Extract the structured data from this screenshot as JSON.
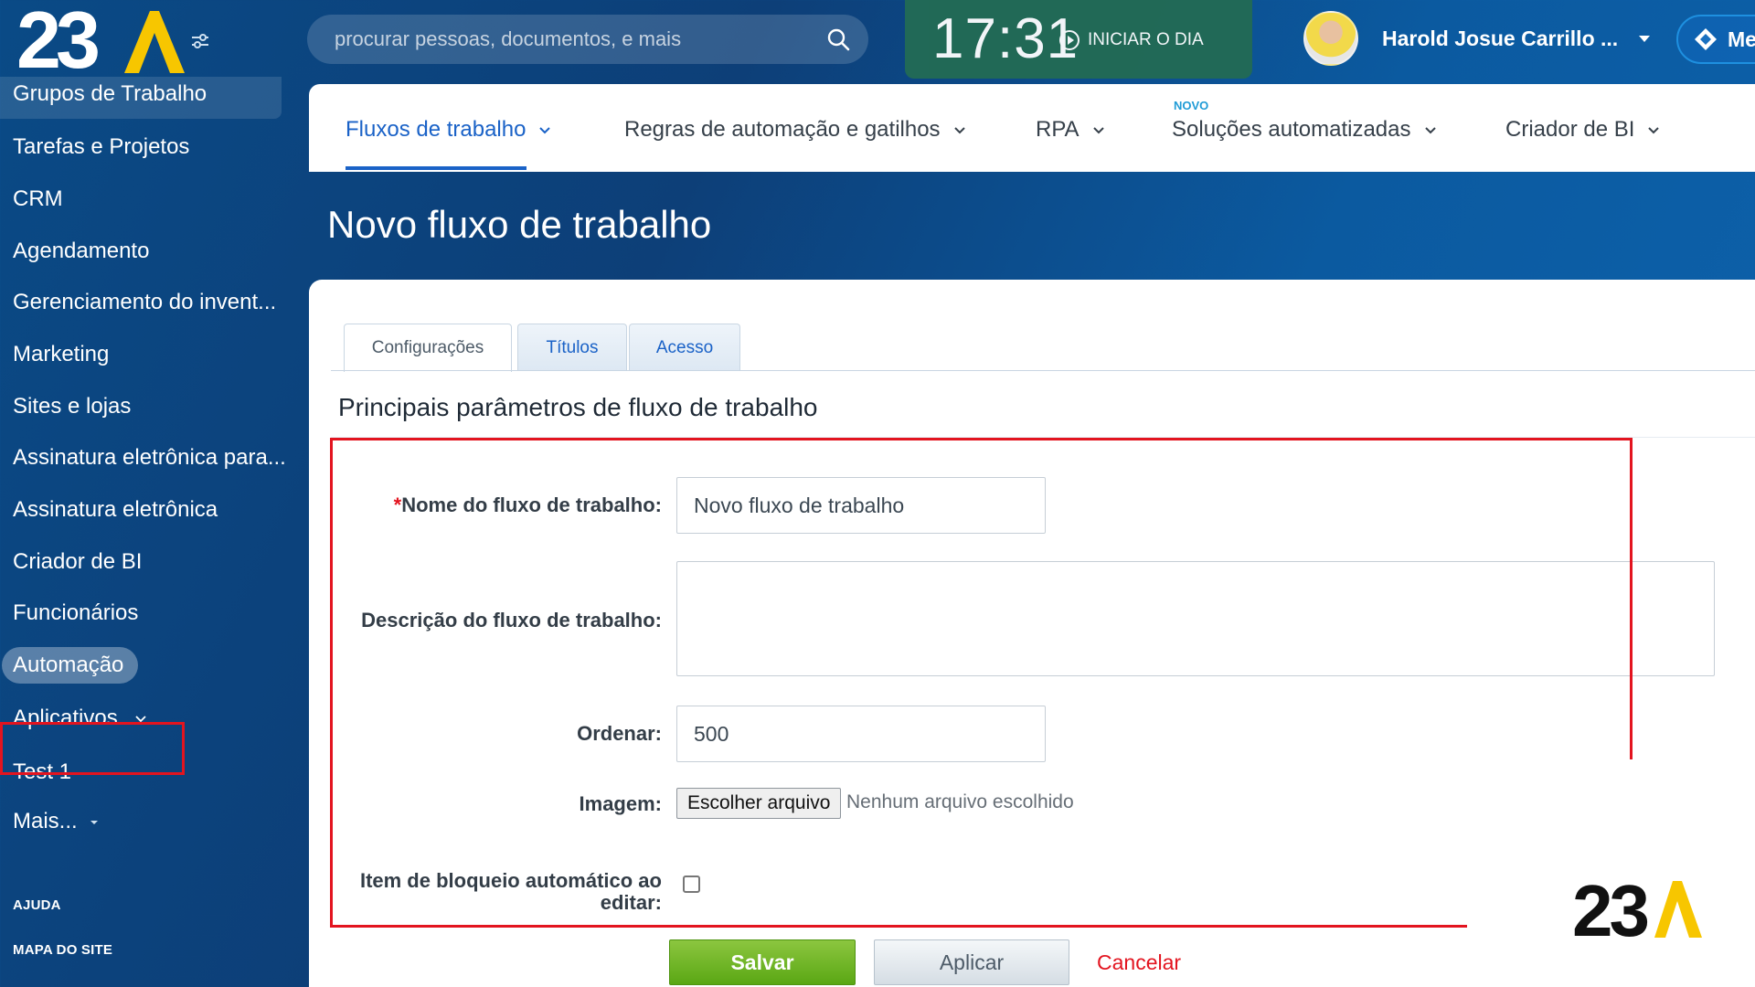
{
  "brand": {
    "logo_text": "23",
    "accent": "#f7c600"
  },
  "header": {
    "search_placeholder": "procurar pessoas, documentos, e mais",
    "clock": "17:31",
    "start_day_label": "INICIAR O DIA",
    "user_name": "Harold Josue Carrillo ...",
    "me_label": "Me"
  },
  "sidebar": {
    "items": [
      "Grupos de Trabalho",
      "Tarefas e Projetos",
      "CRM",
      "Agendamento",
      "Gerenciamento do invent...",
      "Marketing",
      "Sites e lojas",
      "Assinatura eletrônica para...",
      "Assinatura eletrônica",
      "Criador de BI",
      "Funcionários",
      "Automação",
      "Aplicativos",
      "Test 1",
      "Mais..."
    ],
    "footer": [
      "AJUDA",
      "MAPA DO SITE"
    ]
  },
  "nav": {
    "items": [
      "Fluxos de trabalho",
      "Regras de automação e gatilhos",
      "RPA",
      "Soluções automatizadas",
      "Criador de BI"
    ],
    "new_badge": "NOVO"
  },
  "page": {
    "title": "Novo fluxo de trabalho"
  },
  "tabs": [
    "Configurações",
    "Títulos",
    "Acesso"
  ],
  "form": {
    "section_title": "Principais parâmetros de fluxo de trabalho",
    "name_required_mark": "*",
    "name_label": "Nome do fluxo de trabalho:",
    "name_value": "Novo fluxo de trabalho",
    "description_label": "Descrição do fluxo de trabalho:",
    "description_value": "",
    "sort_label": "Ordenar:",
    "sort_value": "500",
    "image_label": "Imagem:",
    "file_button": "Escolher arquivo",
    "file_status": "Nenhum arquivo escolhido",
    "autolock_label_line1": "Item de bloqueio automático ao",
    "autolock_label_line2": "editar:"
  },
  "actions": {
    "save": "Salvar",
    "apply": "Aplicar",
    "cancel": "Cancelar"
  }
}
